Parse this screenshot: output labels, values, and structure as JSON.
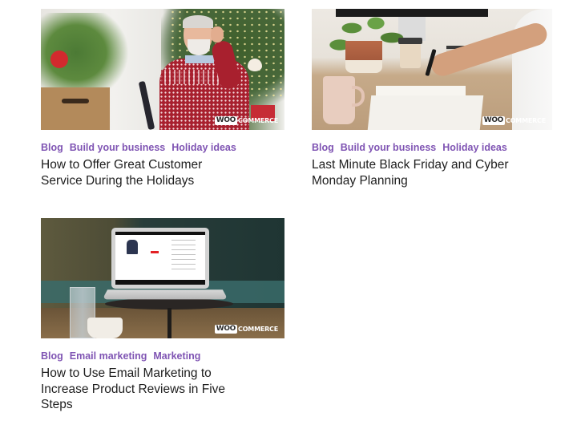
{
  "posts": [
    {
      "image_alt": "Smiling older man in a red holiday sweater talking on the phone near a Christmas tree",
      "logo": {
        "badge": "WOO",
        "text": "COMMERCE"
      },
      "tags": [
        "Blog",
        "Build your business",
        "Holiday ideas"
      ],
      "title": "How to Offer Great Customer Service During the Holidays"
    },
    {
      "image_alt": "Person writing in a planner at a desk with a mug and potted plant",
      "logo": {
        "badge": "WOO",
        "text": "COMMERCE"
      },
      "tags": [
        "Blog",
        "Build your business",
        "Holiday ideas"
      ],
      "title": "Last Minute Black Friday and Cyber Monday Planning"
    },
    {
      "image_alt": "Laptop showing an online store product page on a small table in a cafe",
      "logo": {
        "badge": "WOO",
        "text": "COMMERCE"
      },
      "tags": [
        "Blog",
        "Email marketing",
        "Marketing"
      ],
      "title": "How to Use Email Marketing to Increase Product Reviews in Five Steps"
    }
  ],
  "colors": {
    "tag": "#7f54b3",
    "title": "#1e1e1e",
    "background": "#ffffff"
  }
}
